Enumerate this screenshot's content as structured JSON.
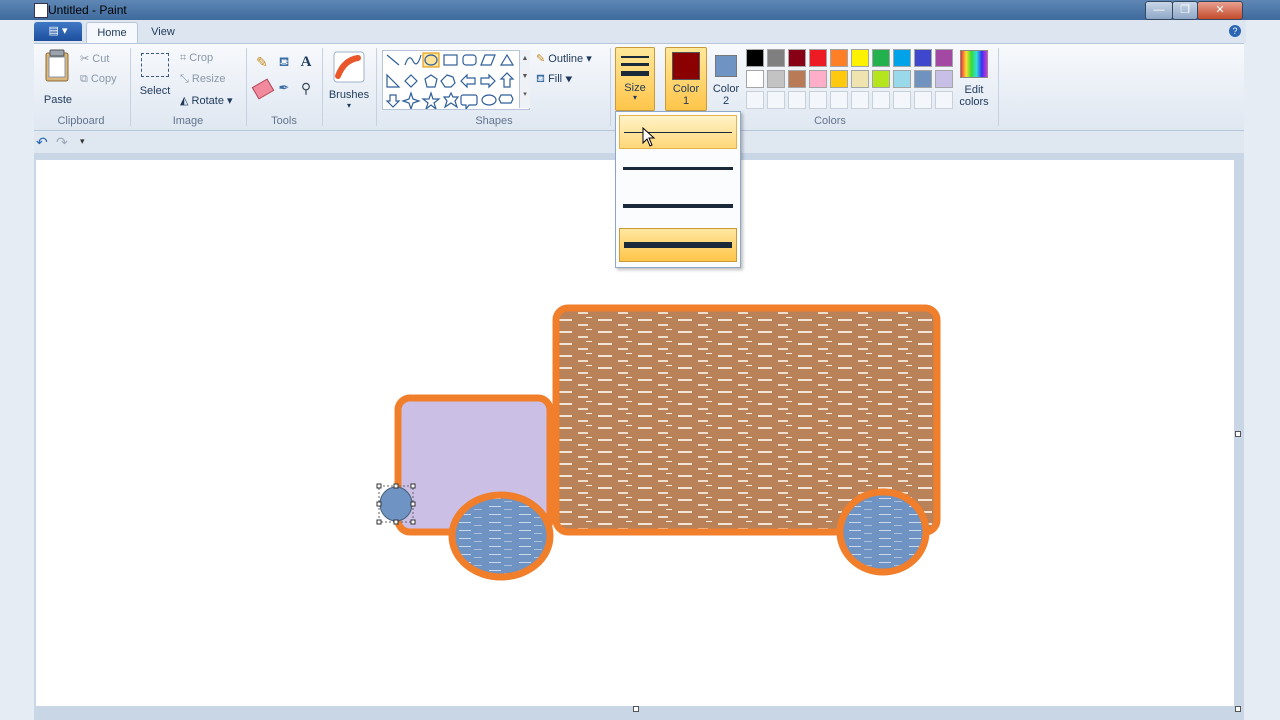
{
  "window": {
    "title": "Untitled - Paint"
  },
  "tabs": {
    "file_label": "▤ ▾",
    "home": "Home",
    "view": "View"
  },
  "clipboard": {
    "paste": "Paste",
    "cut": "Cut",
    "copy": "Copy",
    "group": "Clipboard"
  },
  "image": {
    "select": "Select",
    "crop": "Crop",
    "resize": "Resize",
    "rotate": "Rotate",
    "group": "Image"
  },
  "tools": {
    "group": "Tools",
    "text_tool": "A"
  },
  "brushes": {
    "label": "Brushes"
  },
  "shapes": {
    "outline": "Outline",
    "fill": "Fill",
    "group": "Shapes"
  },
  "size": {
    "label": "Size"
  },
  "colors": {
    "color1_label_line1": "Color",
    "color1_label_line2": "1",
    "color2_label_line1": "Color",
    "color2_label_line2": "2",
    "color1_value": "#8b0000",
    "color2_value": "#6f93c2",
    "edit_line1": "Edit",
    "edit_line2": "colors",
    "group": "Colors",
    "palette_row1": [
      "#000000",
      "#7f7f7f",
      "#880015",
      "#ed1c24",
      "#ff7f27",
      "#fff200",
      "#22b14c",
      "#00a2e8",
      "#3f48cc",
      "#a349a4"
    ],
    "palette_row2": [
      "#ffffff",
      "#c3c3c3",
      "#b97a57",
      "#ffaec9",
      "#ffc90e",
      "#efe4b0",
      "#b5e61d",
      "#99d9ea",
      "#7092be",
      "#c8bfe7"
    ]
  },
  "size_menu": {
    "options": [
      "1px",
      "3px",
      "5px",
      "8px"
    ],
    "selected_index": 3,
    "hovered_index": 0
  },
  "drawing": {
    "outline_color": "#f07e2b",
    "cab_fill": "#cbbfe6",
    "cargo_fill": "#b98259",
    "wheel_fill": "#6f93c2"
  }
}
